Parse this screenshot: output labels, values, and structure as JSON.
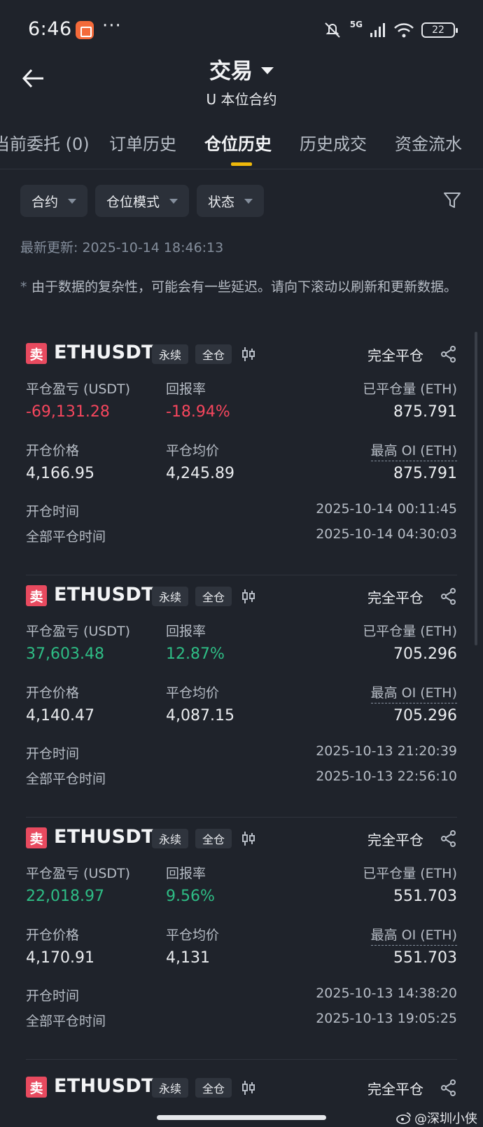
{
  "status_bar": {
    "time": "6:46",
    "dots": "···",
    "network": "5G",
    "battery": "22"
  },
  "header": {
    "title": "交易",
    "subtitle": "U 本位合约"
  },
  "tabs": [
    {
      "label": "当前委托 (0)"
    },
    {
      "label": "订单历史"
    },
    {
      "label": "仓位历史",
      "active": true
    },
    {
      "label": "历史成交"
    },
    {
      "label": "资金流水"
    }
  ],
  "filters": [
    {
      "label": "合约"
    },
    {
      "label": "仓位模式"
    },
    {
      "label": "状态"
    }
  ],
  "last_updated": "最新更新: 2025-10-14 18:46:13",
  "note": "由于数据的复杂性，可能会有一些延迟。请向下滚动以刷新和更新数据。",
  "labels": {
    "pnl": "平仓盈亏 (USDT)",
    "roi": "回报率",
    "closed_qty": "已平仓量 (ETH)",
    "open_price": "开仓价格",
    "close_avg": "平仓均价",
    "max_oi": "最高 OI (ETH)",
    "open_time": "开仓时间",
    "close_time": "全部平仓时间"
  },
  "positions": [
    {
      "side": "卖",
      "symbol": "ETHUSDT",
      "tag1": "永续",
      "tag2": "全仓",
      "status": "完全平仓",
      "pnl": "-69,131.28",
      "roi": "-18.94%",
      "closed_qty": "875.791",
      "open_price": "4,166.95",
      "close_avg": "4,245.89",
      "max_oi": "875.791",
      "open_time": "2025-10-14 00:11:45",
      "close_time": "2025-10-14 04:30:03",
      "positive": false
    },
    {
      "side": "卖",
      "symbol": "ETHUSDT",
      "tag1": "永续",
      "tag2": "全仓",
      "status": "完全平仓",
      "pnl": "37,603.48",
      "roi": "12.87%",
      "closed_qty": "705.296",
      "open_price": "4,140.47",
      "close_avg": "4,087.15",
      "max_oi": "705.296",
      "open_time": "2025-10-13 21:20:39",
      "close_time": "2025-10-13 22:56:10",
      "positive": true
    },
    {
      "side": "卖",
      "symbol": "ETHUSDT",
      "tag1": "永续",
      "tag2": "全仓",
      "status": "完全平仓",
      "pnl": "22,018.97",
      "roi": "9.56%",
      "closed_qty": "551.703",
      "open_price": "4,170.91",
      "close_avg": "4,131",
      "max_oi": "551.703",
      "open_time": "2025-10-13 14:38:20",
      "close_time": "2025-10-13 19:05:25",
      "positive": true
    },
    {
      "side": "卖",
      "symbol": "ETHUSDT",
      "tag1": "永续",
      "tag2": "全仓",
      "status": "完全平仓"
    }
  ],
  "watermark": "@深圳小侠",
  "colors": {
    "sell": "#e84a5f",
    "negative": "#f6465d",
    "positive": "#2ebd85",
    "accent": "#f0b90b",
    "background": "#1f232b"
  }
}
